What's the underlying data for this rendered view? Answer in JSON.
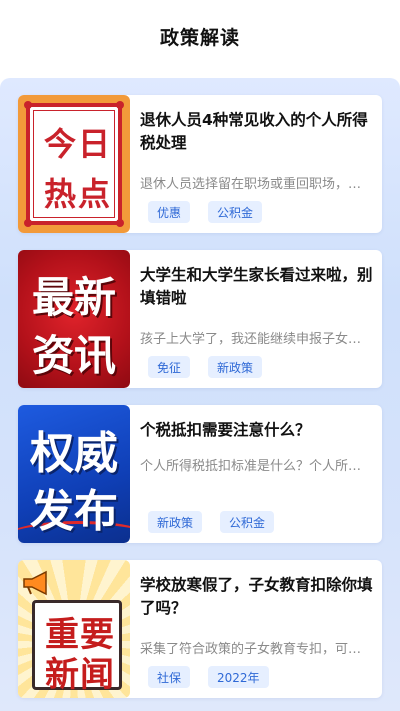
{
  "header": {
    "title": "政策解读"
  },
  "articles": [
    {
      "thumb_text": [
        "今日",
        "热点"
      ],
      "title": "退休人员4种常见收入的个人所得税处理",
      "desc": "退休人员选择留在职场或重回职场，…",
      "tags": [
        "优惠",
        "公积金"
      ]
    },
    {
      "thumb_text": [
        "最新",
        "资讯"
      ],
      "title": "大学生和大学生家长看过来啦，别填错啦",
      "desc": "孩子上大学了，我还能继续申报子女…",
      "tags": [
        "免征",
        "新政策"
      ]
    },
    {
      "thumb_text": [
        "权威",
        "发布"
      ],
      "title": "个税抵扣需要注意什么？",
      "desc": "个人所得税抵扣标准是什么？个人所…",
      "tags": [
        "新政策",
        "公积金"
      ]
    },
    {
      "thumb_text": [
        "重要",
        "新闻"
      ],
      "title": "学校放寒假了，子女教育扣除你填了吗？",
      "desc": "采集了符合政策的子女教育专扣，可…",
      "tags": [
        "社保",
        "2022年"
      ]
    }
  ],
  "colors": {
    "accent": "#2f69d6",
    "tag_bg": "#e6efff",
    "page_bg": "#d6e3fb"
  }
}
